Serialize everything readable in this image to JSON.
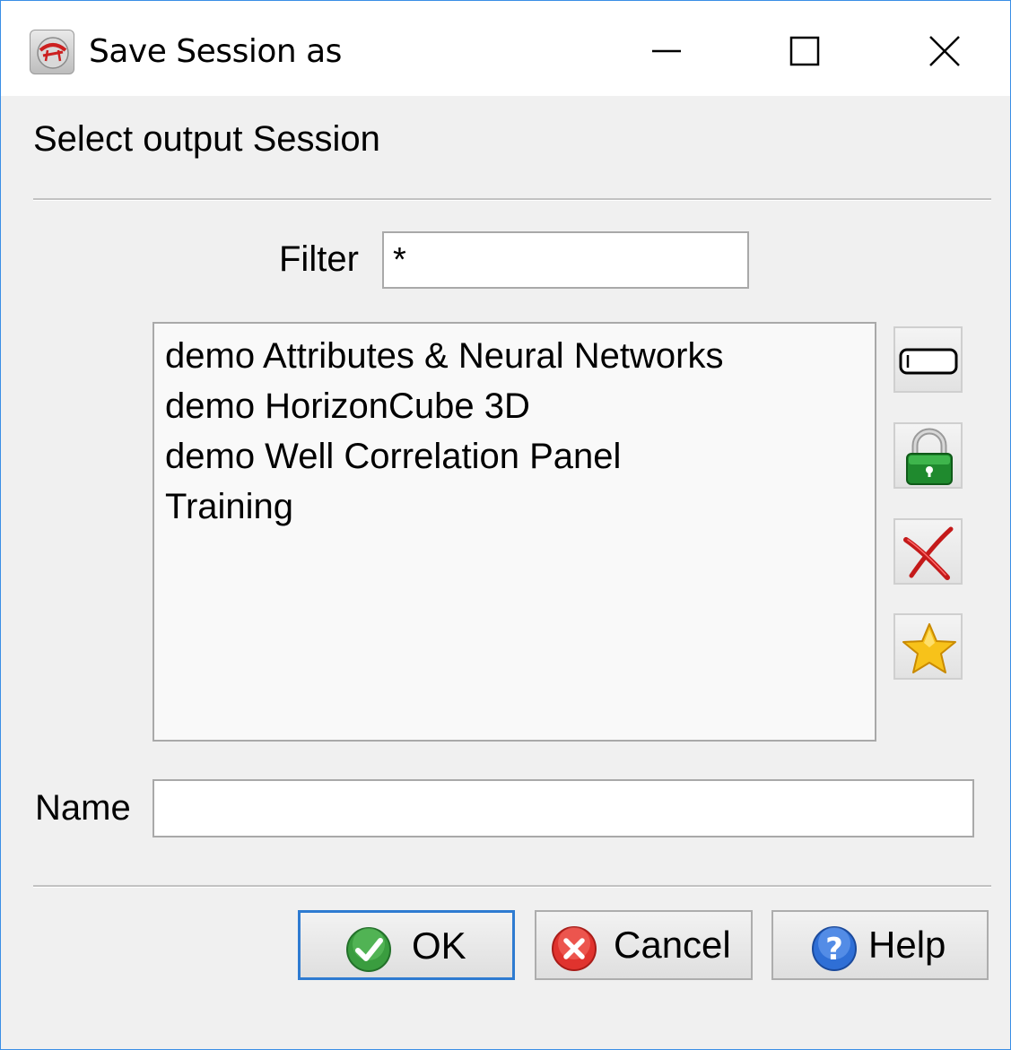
{
  "window": {
    "title": "Save Session as",
    "app_icon": "app-logo-icon",
    "controls": {
      "minimize_icon": "minimize-icon",
      "maximize_icon": "maximize-icon",
      "close_icon": "close-icon"
    }
  },
  "dialog": {
    "heading": "Select output Session",
    "filter": {
      "label": "Filter",
      "value": "*"
    },
    "sessions": [
      "demo Attributes & Neural Networks",
      "demo HorizonCube 3D",
      "demo Well Correlation Panel",
      "Training"
    ],
    "side_buttons": [
      {
        "icon": "rename-icon"
      },
      {
        "icon": "lock-icon"
      },
      {
        "icon": "delete-icon"
      },
      {
        "icon": "star-icon"
      }
    ],
    "name": {
      "label": "Name",
      "value": ""
    }
  },
  "buttons": {
    "ok": {
      "label": "OK",
      "icon": "checkmark-icon"
    },
    "cancel": {
      "label": "Cancel",
      "icon": "cancel-icon"
    },
    "help": {
      "label": "Help",
      "icon": "help-icon"
    }
  },
  "colors": {
    "focus_border": "#2e7bd1",
    "window_border": "#3a8ee6",
    "dialog_bg": "#f0f0f0"
  }
}
